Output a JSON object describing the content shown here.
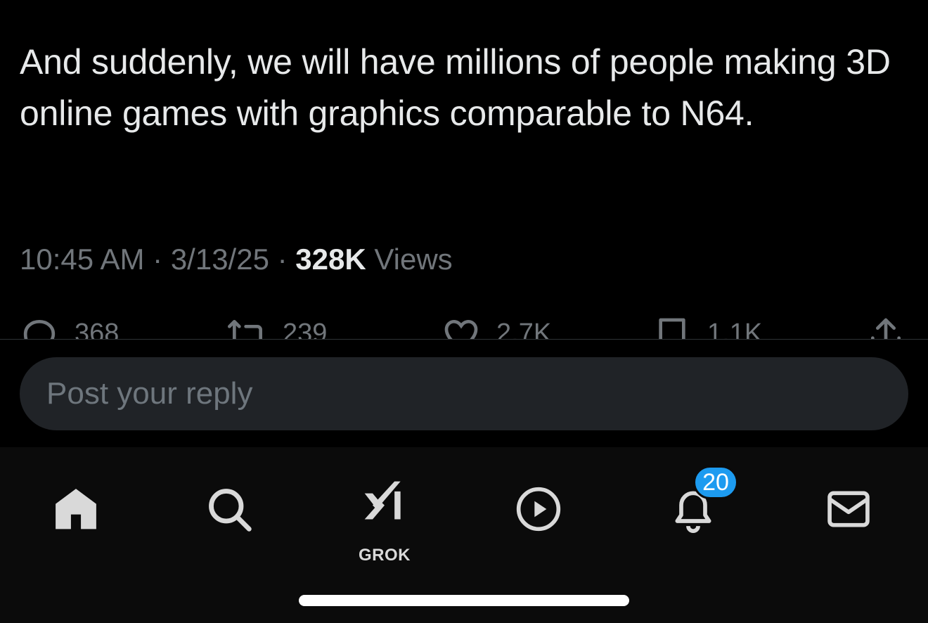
{
  "tweet": {
    "text": "And suddenly, we will have millions of people making 3D online games with graphics comparable to N64.",
    "time": "10:45 AM",
    "date": "3/13/25",
    "separator": "·",
    "views_count": "328K",
    "views_label": "Views"
  },
  "actions": {
    "reply_count": "368",
    "repost_count": "239",
    "like_count": "2.7K",
    "bookmark_count": "1.1K"
  },
  "reply": {
    "placeholder": "Post your reply"
  },
  "tabbar": {
    "grok_label": "GROK",
    "notifications_badge": "20",
    "icons": [
      "home-icon",
      "search-icon",
      "grok-icon",
      "play-icon",
      "bell-icon",
      "mail-icon"
    ]
  },
  "colors": {
    "background": "#000000",
    "text": "#e7e9ea",
    "muted": "#71767b",
    "accent": "#1d9bf0",
    "reply_box": "#202327"
  }
}
